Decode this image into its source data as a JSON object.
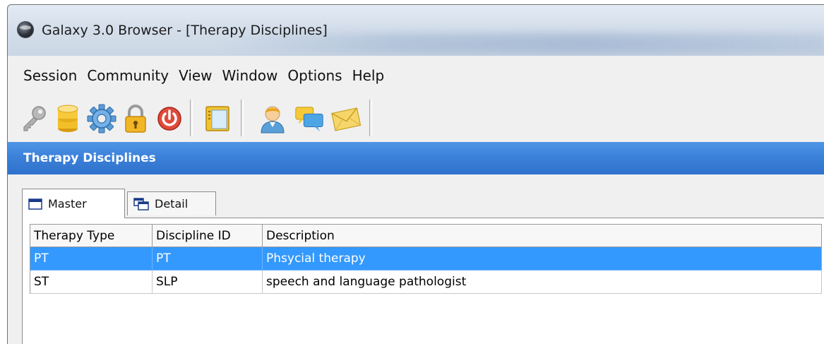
{
  "window": {
    "title": "Galaxy 3.0 Browser - [Therapy Disciplines]"
  },
  "menu": {
    "items": [
      "Session",
      "Community",
      "View",
      "Window",
      "Options",
      "Help"
    ]
  },
  "toolbar": {
    "buttons": [
      {
        "icon": "key-icon"
      },
      {
        "icon": "database-icon"
      },
      {
        "icon": "gear-icon"
      },
      {
        "icon": "lock-icon"
      },
      {
        "icon": "power-icon"
      },
      {
        "icon": "panel-icon"
      },
      {
        "icon": "user-icon"
      },
      {
        "icon": "chat-icon"
      },
      {
        "icon": "mail-icon"
      }
    ]
  },
  "section": {
    "title": "Therapy Disciplines"
  },
  "tabs": [
    {
      "label": "Master",
      "active": true,
      "icon": "window-icon"
    },
    {
      "label": "Detail",
      "active": false,
      "icon": "windows-icon"
    }
  ],
  "grid": {
    "columns": [
      "Therapy Type",
      "Discipline ID",
      "Description"
    ],
    "rows": [
      {
        "therapy_type": "PT",
        "discipline_id": "PT",
        "description": "Phsycial therapy",
        "selected": true
      },
      {
        "therapy_type": "ST",
        "discipline_id": "SLP",
        "description": "speech and language pathologist",
        "selected": false
      }
    ]
  },
  "colors": {
    "header_blue": "#3a7fd8",
    "selection_blue": "#3399ff"
  }
}
